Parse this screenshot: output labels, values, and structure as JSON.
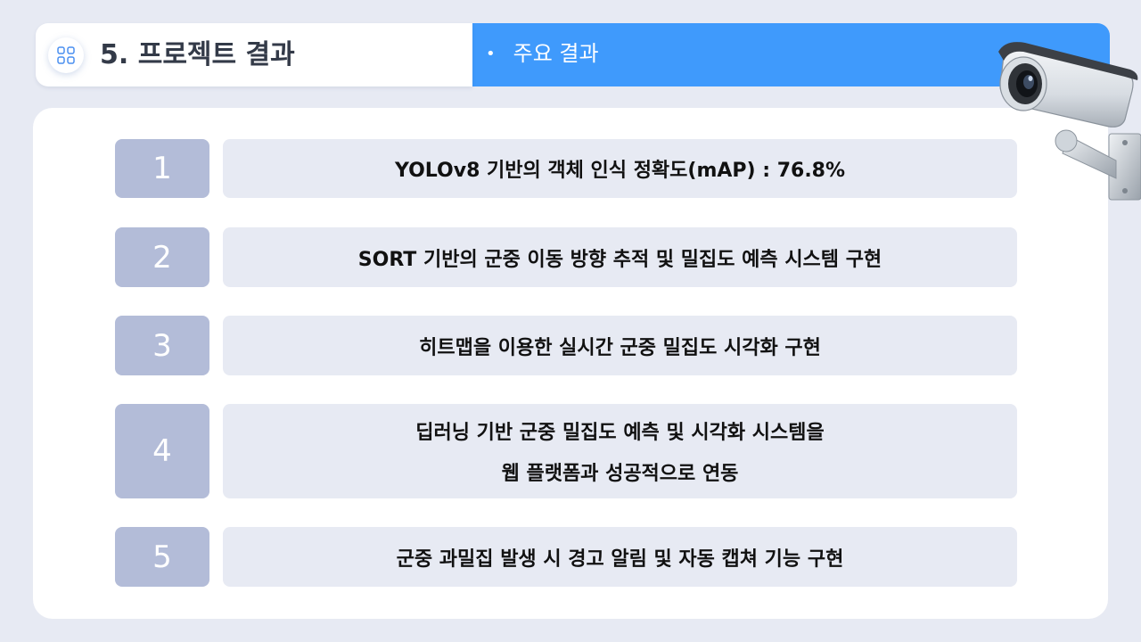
{
  "header": {
    "title": "5. 프로젝트 결과",
    "subtitle": "주요 결과",
    "bullet": "•"
  },
  "results": [
    {
      "number": "1",
      "lines": [
        "YOLOv8 기반의 객체 인식 정확도(mAP) : 76.8%"
      ]
    },
    {
      "number": "2",
      "lines": [
        "SORT 기반의 군중 이동 방향 추적 및 밀집도 예측 시스템 구현"
      ]
    },
    {
      "number": "3",
      "lines": [
        "히트맵을 이용한 실시간 군중 밀집도 시각화 구현"
      ]
    },
    {
      "number": "4",
      "lines": [
        "딥러닝 기반 군중 밀집도 예측 및 시각화 시스템을",
        "웹 플랫폼과 성공적으로 연동"
      ]
    },
    {
      "number": "5",
      "lines": [
        "군중 과밀집 발생 시 경고 알림 및 자동 캡쳐 기능 구현"
      ]
    }
  ],
  "icons": {
    "title_icon": "grid-icon",
    "illustration": "security-camera-icon"
  },
  "colors": {
    "accent": "#3f9afc",
    "number_box": "#b3bcd8",
    "text_box": "#e7eaf3",
    "background": "#e7eaf3"
  }
}
